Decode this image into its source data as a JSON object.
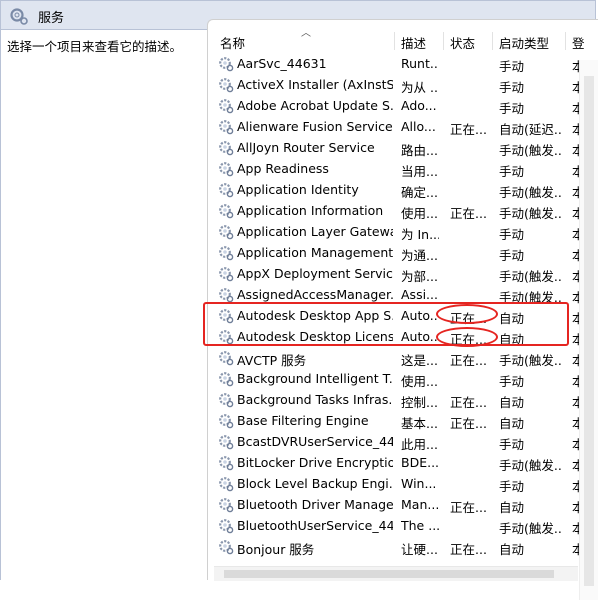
{
  "window": {
    "title": "服务"
  },
  "left_pane": {
    "description": "选择一个项目来查看它的描述。"
  },
  "columns": {
    "name": "名称",
    "desc": "描述",
    "status": "状态",
    "startup": "启动类型",
    "logon": "登"
  },
  "rows": [
    {
      "name": "AarSvc_44631",
      "desc": "Runt...",
      "status": "",
      "start": "手动",
      "log": "本"
    },
    {
      "name": "ActiveX Installer (AxInstSV)",
      "desc": "为从 ...",
      "status": "",
      "start": "手动",
      "log": "本"
    },
    {
      "name": "Adobe Acrobat Update S...",
      "desc": "Ado...",
      "status": "",
      "start": "手动",
      "log": "本"
    },
    {
      "name": "Alienware Fusion Service",
      "desc": "Allo...",
      "status": "正在...",
      "start": "自动(延迟...",
      "log": "本"
    },
    {
      "name": "AllJoyn Router Service",
      "desc": "路由...",
      "status": "",
      "start": "手动(触发...",
      "log": "本"
    },
    {
      "name": "App Readiness",
      "desc": "当用...",
      "status": "",
      "start": "手动",
      "log": "本"
    },
    {
      "name": "Application Identity",
      "desc": "确定...",
      "status": "",
      "start": "手动(触发...",
      "log": "本"
    },
    {
      "name": "Application Information",
      "desc": "使用...",
      "status": "正在...",
      "start": "手动(触发...",
      "log": "本"
    },
    {
      "name": "Application Layer Gatewa...",
      "desc": "为 In...",
      "status": "",
      "start": "手动",
      "log": "本"
    },
    {
      "name": "Application Management",
      "desc": "为通...",
      "status": "",
      "start": "手动",
      "log": "本"
    },
    {
      "name": "AppX Deployment Servic...",
      "desc": "为部...",
      "status": "",
      "start": "手动(触发...",
      "log": "本"
    },
    {
      "name": "AssignedAccessManager...",
      "desc": "Assi...",
      "status": "",
      "start": "手动(触发...",
      "log": "本"
    },
    {
      "name": "Autodesk Desktop App S...",
      "desc": "Auto...",
      "status": "正在...",
      "start": "自动",
      "log": "本"
    },
    {
      "name": "Autodesk Desktop Licens...",
      "desc": "Auto...",
      "status": "正在...",
      "start": "自动",
      "log": "本"
    },
    {
      "name": "AVCTP 服务",
      "desc": "这是...",
      "status": "正在...",
      "start": "手动(触发...",
      "log": "本"
    },
    {
      "name": "Background Intelligent T...",
      "desc": "使用...",
      "status": "",
      "start": "手动",
      "log": "本"
    },
    {
      "name": "Background Tasks Infras...",
      "desc": "控制...",
      "status": "正在...",
      "start": "自动",
      "log": "本"
    },
    {
      "name": "Base Filtering Engine",
      "desc": "基本...",
      "status": "正在...",
      "start": "自动",
      "log": "本"
    },
    {
      "name": "BcastDVRUserService_44...",
      "desc": "此用...",
      "status": "",
      "start": "手动",
      "log": "本"
    },
    {
      "name": "BitLocker Drive Encryptio...",
      "desc": "BDE...",
      "status": "",
      "start": "手动(触发...",
      "log": "本"
    },
    {
      "name": "Block Level Backup Engi...",
      "desc": "Win...",
      "status": "",
      "start": "手动",
      "log": "本"
    },
    {
      "name": "Bluetooth Driver Manage...",
      "desc": "Man...",
      "status": "正在...",
      "start": "自动",
      "log": "本"
    },
    {
      "name": "BluetoothUserService_44...",
      "desc": "The ...",
      "status": "",
      "start": "手动(触发...",
      "log": "本"
    },
    {
      "name": "Bonjour 服务",
      "desc": "让硬...",
      "status": "正在...",
      "start": "自动",
      "log": "本"
    }
  ],
  "annotations": {
    "color": "#e52521",
    "highlight_rows": [
      12,
      13
    ]
  }
}
